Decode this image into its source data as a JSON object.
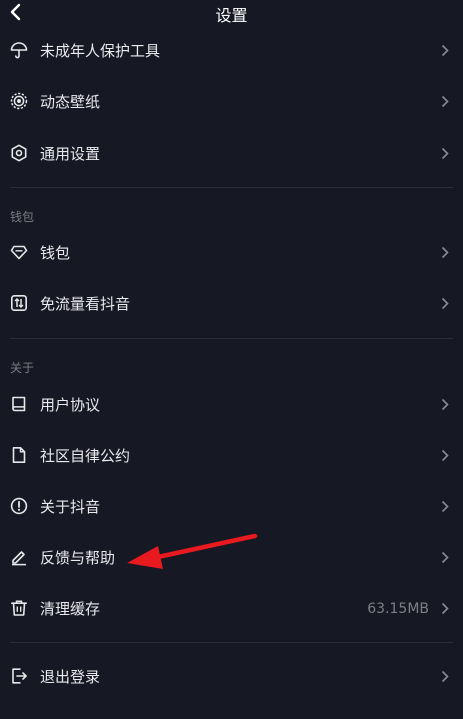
{
  "header": {
    "title": "设置",
    "back_icon": "chevron-left-icon"
  },
  "groups": {
    "general": [
      {
        "label": "未成年人保护工具",
        "icon": "umbrella-icon"
      },
      {
        "label": "动态壁纸",
        "icon": "live-wallpaper-icon"
      },
      {
        "label": "通用设置",
        "icon": "hexagon-settings-icon"
      }
    ],
    "wallet_section": "钱包",
    "wallet": [
      {
        "label": "钱包",
        "icon": "diamond-icon"
      },
      {
        "label": "免流量看抖音",
        "icon": "data-saver-icon"
      }
    ],
    "about_section": "关于",
    "about": [
      {
        "label": "用户协议",
        "icon": "book-icon"
      },
      {
        "label": "社区自律公约",
        "icon": "document-icon"
      },
      {
        "label": "关于抖音",
        "icon": "info-icon"
      },
      {
        "label": "反馈与帮助",
        "icon": "pencil-icon"
      },
      {
        "label": "清理缓存",
        "icon": "trash-icon",
        "value": "63.15MB"
      }
    ],
    "logout": {
      "label": "退出登录",
      "icon": "logout-icon"
    }
  },
  "colors": {
    "background": "#161823",
    "text": "#eaeaec",
    "muted": "#7a7c85",
    "annotation": "#e8191f"
  }
}
